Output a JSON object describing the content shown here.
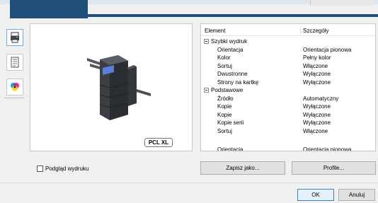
{
  "settings_table": {
    "headers": {
      "element": "Element",
      "details": "Szczegóły"
    },
    "rows": [
      {
        "type": "group",
        "name": "Szybki wydruk"
      },
      {
        "type": "item",
        "name": "Orientacja",
        "value": "Orientacja pionowa"
      },
      {
        "type": "item",
        "name": "Kolor",
        "value": "Pełny kolor"
      },
      {
        "type": "item",
        "name": "Sortuj",
        "value": "Włączone"
      },
      {
        "type": "item",
        "name": "Dwustronne",
        "value": "Wyłączone"
      },
      {
        "type": "item",
        "name": "Strony na kartkę",
        "value": "Wyłączone"
      },
      {
        "type": "group",
        "name": "Podstawowe"
      },
      {
        "type": "item",
        "name": "Źródło",
        "value": "Automatyczny"
      },
      {
        "type": "item",
        "name": "Kopie",
        "value": "Wyłączone"
      },
      {
        "type": "item",
        "name": "Kopie",
        "value": "Wyłączone"
      },
      {
        "type": "item",
        "name": "Kopie serii",
        "value": "Wyłączone"
      },
      {
        "type": "item",
        "name": "Sortuj",
        "value": "Włączone"
      },
      {
        "type": "item",
        "name": "Orientacja",
        "value": "Orientacja pionowa"
      }
    ]
  },
  "preview": {
    "pdl_badge": "PCL XL"
  },
  "print_preview_checkbox": {
    "label": "Podgląd wydruku",
    "checked": false
  },
  "buttons": {
    "save_as": "Zapisz jako...",
    "profiles": "Profile...",
    "ok": "OK",
    "cancel": "Anuluj"
  },
  "side_icons": [
    "printer-settings-icon",
    "document-icon",
    "color-icon"
  ],
  "colors": {
    "accent": "#1f4e79",
    "selection": "#7aa7d6"
  }
}
